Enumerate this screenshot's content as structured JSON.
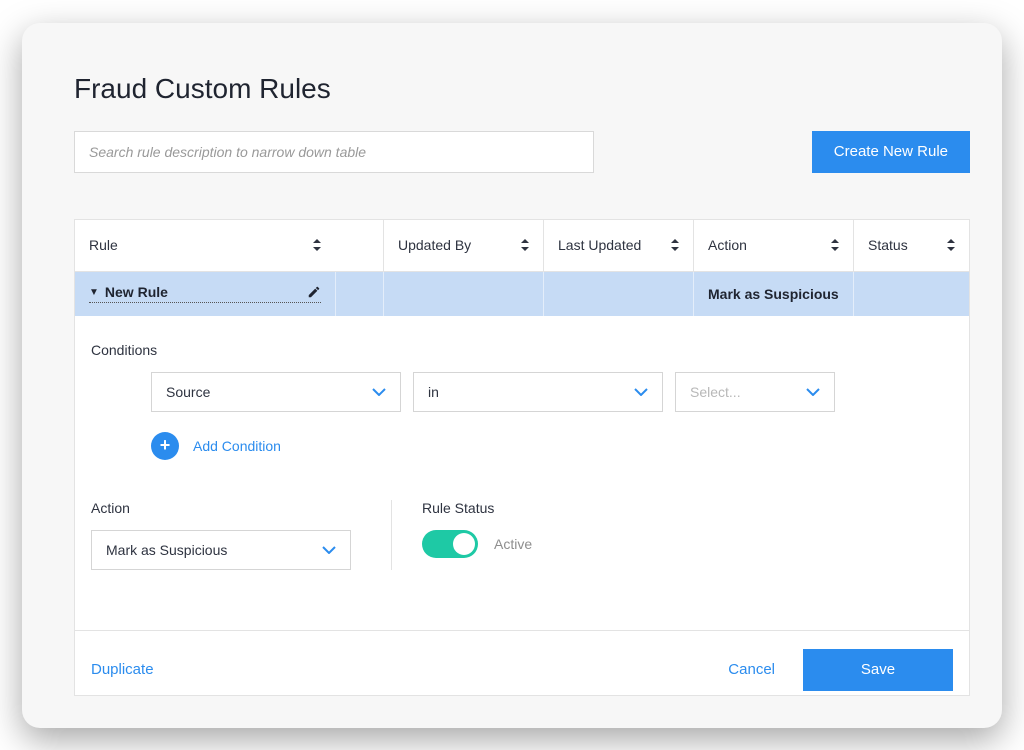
{
  "page": {
    "title": "Fraud Custom Rules",
    "search_placeholder": "Search rule description to narrow down table",
    "create_button": "Create New Rule"
  },
  "table": {
    "headers": {
      "rule": "Rule",
      "updated_by": "Updated By",
      "last_updated": "Last Updated",
      "action": "Action",
      "status": "Status"
    },
    "row": {
      "rule_name": "New Rule",
      "updated_by": "",
      "last_updated": "",
      "action": "Mark as Suspicious",
      "status": ""
    }
  },
  "editor": {
    "conditions_label": "Conditions",
    "condition": {
      "field": "Source",
      "operator": "in",
      "value_placeholder": "Select..."
    },
    "add_condition": "Add Condition",
    "action_label": "Action",
    "action_value": "Mark as Suspicious",
    "status_label": "Rule Status",
    "status_value": "Active"
  },
  "footer": {
    "duplicate": "Duplicate",
    "cancel": "Cancel",
    "save": "Save"
  }
}
